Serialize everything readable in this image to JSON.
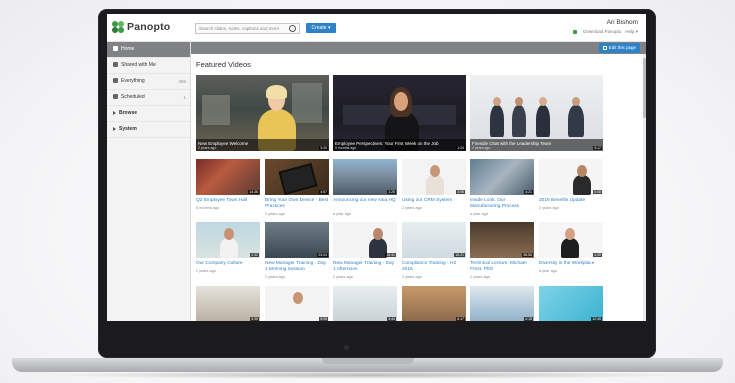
{
  "app": {
    "logo_text": "Panopto"
  },
  "header": {
    "search_placeholder": "Search slides, notes, captions and more",
    "create_label": "Create ▾",
    "user_name": "Ari Bishom",
    "download_label": "Download Panopto",
    "help_label": "Help ▾"
  },
  "sidebar": {
    "items": [
      {
        "label": "Home",
        "icon": "home-icon",
        "count": ""
      },
      {
        "label": "Shared with Me",
        "icon": "share-icon",
        "count": ""
      },
      {
        "label": "Everything",
        "icon": "list-icon",
        "count": "396"
      },
      {
        "label": "Scheduled",
        "icon": "clock-icon",
        "count": "1"
      },
      {
        "label": "Browse",
        "icon": "caret-right-icon",
        "count": ""
      },
      {
        "label": "System",
        "icon": "caret-right-icon",
        "count": ""
      }
    ]
  },
  "main": {
    "edit_label": "Edit this page",
    "featured_title": "Featured Videos",
    "featured": [
      {
        "title": "New Employee Welcome",
        "age": "2 years ago",
        "duration": "3:20"
      },
      {
        "title": "Employee Perspectives: Your First Week on the Job",
        "age": "9 months ago",
        "duration": "1:24"
      },
      {
        "title": "Fireside Chat with the Leadership Team",
        "age": "2 years ago",
        "duration": "3:17"
      }
    ],
    "row2": [
      {
        "title": "Q2 Employee Town Hall",
        "age": "6 months ago",
        "duration": "14:36"
      },
      {
        "title": "Bring Your Own Device - Best Practices",
        "age": "2 years ago",
        "duration": "4:57"
      },
      {
        "title": "Announcing our new Asia HQ",
        "age": "a year ago",
        "duration": "1:25"
      },
      {
        "title": "Using our CRM System",
        "age": "2 years ago",
        "duration": "3:55"
      },
      {
        "title": "Inside Look: Our Manufacturing Process",
        "age": "a year ago",
        "duration": "4:21"
      },
      {
        "title": "2016 Benefits Update",
        "age": "2 years ago",
        "duration": "5:08"
      }
    ],
    "row3": [
      {
        "title": "Our Company Culture",
        "age": "2 years ago",
        "duration": "2:32"
      },
      {
        "title": "New Manager Training - Day 1 Morning Session",
        "age": "2 years ago",
        "duration": "23:04"
      },
      {
        "title": "New Manager Training - Day 1 Afternoon",
        "age": "2 years ago",
        "duration": "15:41"
      },
      {
        "title": "Compliance Training - H2 2016",
        "age": "2 years ago",
        "duration": "18:21"
      },
      {
        "title": "Technical Lecture: Michael Frost, PhD",
        "age": "2 years ago",
        "duration": "38:56"
      },
      {
        "title": "Diversity in the Workplace",
        "age": "a year ago",
        "duration": "4:30"
      }
    ],
    "row4": [
      {
        "duration": "5:35"
      },
      {
        "duration": "5:08"
      },
      {
        "duration": "3:44"
      },
      {
        "duration": "6:17"
      },
      {
        "duration": "2:15"
      },
      {
        "duration": "12:45"
      }
    ]
  },
  "colors": {
    "accent": "#2f82c6",
    "brand": "#3a9a47",
    "topbar": "#808284"
  }
}
